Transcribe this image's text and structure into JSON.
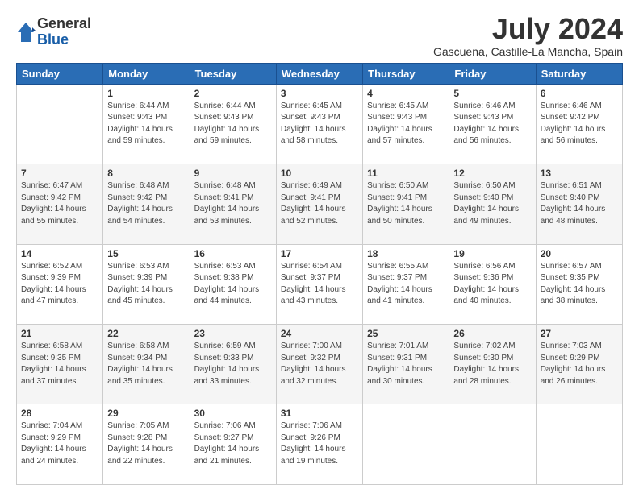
{
  "logo": {
    "general": "General",
    "blue": "Blue"
  },
  "title": "July 2024",
  "subtitle": "Gascuena, Castille-La Mancha, Spain",
  "days": [
    "Sunday",
    "Monday",
    "Tuesday",
    "Wednesday",
    "Thursday",
    "Friday",
    "Saturday"
  ],
  "weeks": [
    [
      {
        "num": "",
        "lines": []
      },
      {
        "num": "1",
        "lines": [
          "Sunrise: 6:44 AM",
          "Sunset: 9:43 PM",
          "Daylight: 14 hours",
          "and 59 minutes."
        ]
      },
      {
        "num": "2",
        "lines": [
          "Sunrise: 6:44 AM",
          "Sunset: 9:43 PM",
          "Daylight: 14 hours",
          "and 59 minutes."
        ]
      },
      {
        "num": "3",
        "lines": [
          "Sunrise: 6:45 AM",
          "Sunset: 9:43 PM",
          "Daylight: 14 hours",
          "and 58 minutes."
        ]
      },
      {
        "num": "4",
        "lines": [
          "Sunrise: 6:45 AM",
          "Sunset: 9:43 PM",
          "Daylight: 14 hours",
          "and 57 minutes."
        ]
      },
      {
        "num": "5",
        "lines": [
          "Sunrise: 6:46 AM",
          "Sunset: 9:43 PM",
          "Daylight: 14 hours",
          "and 56 minutes."
        ]
      },
      {
        "num": "6",
        "lines": [
          "Sunrise: 6:46 AM",
          "Sunset: 9:42 PM",
          "Daylight: 14 hours",
          "and 56 minutes."
        ]
      }
    ],
    [
      {
        "num": "7",
        "lines": [
          "Sunrise: 6:47 AM",
          "Sunset: 9:42 PM",
          "Daylight: 14 hours",
          "and 55 minutes."
        ]
      },
      {
        "num": "8",
        "lines": [
          "Sunrise: 6:48 AM",
          "Sunset: 9:42 PM",
          "Daylight: 14 hours",
          "and 54 minutes."
        ]
      },
      {
        "num": "9",
        "lines": [
          "Sunrise: 6:48 AM",
          "Sunset: 9:41 PM",
          "Daylight: 14 hours",
          "and 53 minutes."
        ]
      },
      {
        "num": "10",
        "lines": [
          "Sunrise: 6:49 AM",
          "Sunset: 9:41 PM",
          "Daylight: 14 hours",
          "and 52 minutes."
        ]
      },
      {
        "num": "11",
        "lines": [
          "Sunrise: 6:50 AM",
          "Sunset: 9:41 PM",
          "Daylight: 14 hours",
          "and 50 minutes."
        ]
      },
      {
        "num": "12",
        "lines": [
          "Sunrise: 6:50 AM",
          "Sunset: 9:40 PM",
          "Daylight: 14 hours",
          "and 49 minutes."
        ]
      },
      {
        "num": "13",
        "lines": [
          "Sunrise: 6:51 AM",
          "Sunset: 9:40 PM",
          "Daylight: 14 hours",
          "and 48 minutes."
        ]
      }
    ],
    [
      {
        "num": "14",
        "lines": [
          "Sunrise: 6:52 AM",
          "Sunset: 9:39 PM",
          "Daylight: 14 hours",
          "and 47 minutes."
        ]
      },
      {
        "num": "15",
        "lines": [
          "Sunrise: 6:53 AM",
          "Sunset: 9:39 PM",
          "Daylight: 14 hours",
          "and 45 minutes."
        ]
      },
      {
        "num": "16",
        "lines": [
          "Sunrise: 6:53 AM",
          "Sunset: 9:38 PM",
          "Daylight: 14 hours",
          "and 44 minutes."
        ]
      },
      {
        "num": "17",
        "lines": [
          "Sunrise: 6:54 AM",
          "Sunset: 9:37 PM",
          "Daylight: 14 hours",
          "and 43 minutes."
        ]
      },
      {
        "num": "18",
        "lines": [
          "Sunrise: 6:55 AM",
          "Sunset: 9:37 PM",
          "Daylight: 14 hours",
          "and 41 minutes."
        ]
      },
      {
        "num": "19",
        "lines": [
          "Sunrise: 6:56 AM",
          "Sunset: 9:36 PM",
          "Daylight: 14 hours",
          "and 40 minutes."
        ]
      },
      {
        "num": "20",
        "lines": [
          "Sunrise: 6:57 AM",
          "Sunset: 9:35 PM",
          "Daylight: 14 hours",
          "and 38 minutes."
        ]
      }
    ],
    [
      {
        "num": "21",
        "lines": [
          "Sunrise: 6:58 AM",
          "Sunset: 9:35 PM",
          "Daylight: 14 hours",
          "and 37 minutes."
        ]
      },
      {
        "num": "22",
        "lines": [
          "Sunrise: 6:58 AM",
          "Sunset: 9:34 PM",
          "Daylight: 14 hours",
          "and 35 minutes."
        ]
      },
      {
        "num": "23",
        "lines": [
          "Sunrise: 6:59 AM",
          "Sunset: 9:33 PM",
          "Daylight: 14 hours",
          "and 33 minutes."
        ]
      },
      {
        "num": "24",
        "lines": [
          "Sunrise: 7:00 AM",
          "Sunset: 9:32 PM",
          "Daylight: 14 hours",
          "and 32 minutes."
        ]
      },
      {
        "num": "25",
        "lines": [
          "Sunrise: 7:01 AM",
          "Sunset: 9:31 PM",
          "Daylight: 14 hours",
          "and 30 minutes."
        ]
      },
      {
        "num": "26",
        "lines": [
          "Sunrise: 7:02 AM",
          "Sunset: 9:30 PM",
          "Daylight: 14 hours",
          "and 28 minutes."
        ]
      },
      {
        "num": "27",
        "lines": [
          "Sunrise: 7:03 AM",
          "Sunset: 9:29 PM",
          "Daylight: 14 hours",
          "and 26 minutes."
        ]
      }
    ],
    [
      {
        "num": "28",
        "lines": [
          "Sunrise: 7:04 AM",
          "Sunset: 9:29 PM",
          "Daylight: 14 hours",
          "and 24 minutes."
        ]
      },
      {
        "num": "29",
        "lines": [
          "Sunrise: 7:05 AM",
          "Sunset: 9:28 PM",
          "Daylight: 14 hours",
          "and 22 minutes."
        ]
      },
      {
        "num": "30",
        "lines": [
          "Sunrise: 7:06 AM",
          "Sunset: 9:27 PM",
          "Daylight: 14 hours",
          "and 21 minutes."
        ]
      },
      {
        "num": "31",
        "lines": [
          "Sunrise: 7:06 AM",
          "Sunset: 9:26 PM",
          "Daylight: 14 hours",
          "and 19 minutes."
        ]
      },
      {
        "num": "",
        "lines": []
      },
      {
        "num": "",
        "lines": []
      },
      {
        "num": "",
        "lines": []
      }
    ]
  ]
}
